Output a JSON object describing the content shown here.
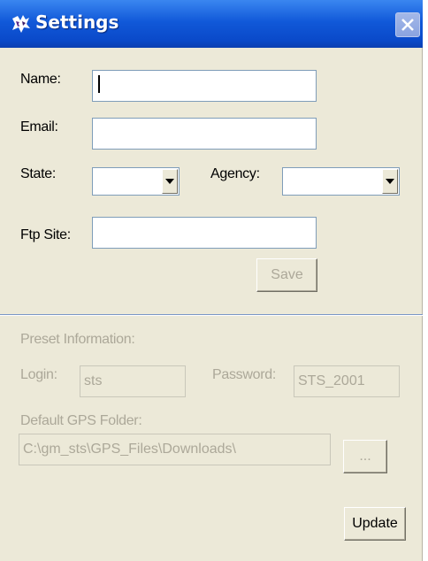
{
  "window": {
    "title": "Settings",
    "app_icon": "app-logo-icon",
    "close_icon": "close-icon"
  },
  "form": {
    "name_label": "Name:",
    "name_value": "",
    "email_label": "Email:",
    "email_value": "",
    "state_label": "State:",
    "state_value": "",
    "agency_label": "Agency:",
    "agency_value": "",
    "ftp_label": "Ftp Site:",
    "ftp_value": "",
    "save_label": "Save"
  },
  "preset": {
    "section_label": "Preset Information:",
    "login_label": "Login:",
    "login_value": "sts",
    "password_label": "Password:",
    "password_value": "STS_2001",
    "gps_folder_label": "Default GPS Folder:",
    "gps_folder_value": "C:\\gm_sts\\GPS_Files\\Downloads\\",
    "browse_label": "...",
    "update_label": "Update"
  },
  "colors": {
    "title_bar": "#0a49c9",
    "background": "#ece9d8",
    "disabled_text": "#aca899"
  }
}
